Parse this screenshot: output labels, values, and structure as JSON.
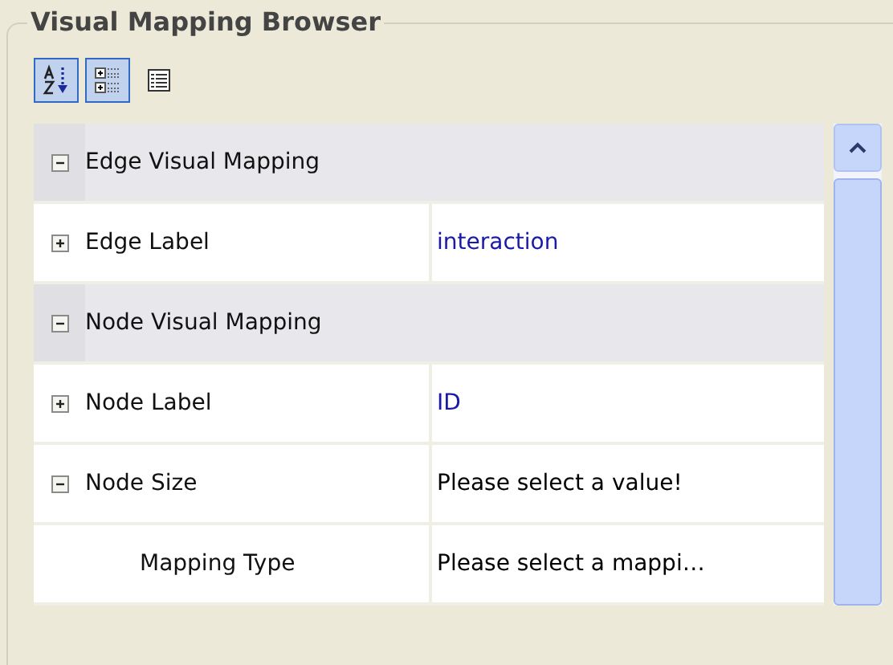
{
  "panel": {
    "title": "Visual Mapping Browser"
  },
  "toolbar": [
    {
      "kind": "sort",
      "selected": true
    },
    {
      "kind": "categories",
      "selected": true
    },
    {
      "kind": "list",
      "selected": false
    }
  ],
  "rows": [
    {
      "kind": "category",
      "label": "Edge Visual Mapping",
      "expanded": true,
      "children": [
        {
          "kind": "property",
          "label": "Edge Label",
          "value": "interaction",
          "color": "#1a1aa8",
          "expanded": false
        }
      ]
    },
    {
      "kind": "category",
      "label": "Node Visual Mapping",
      "expanded": true,
      "children": [
        {
          "kind": "property",
          "label": "Node Label",
          "value": "ID",
          "color": "#1a1aa8",
          "expanded": false
        },
        {
          "kind": "property",
          "label": "Node Size",
          "value": "Please select a value!",
          "color": "#000000",
          "expanded": true,
          "children": [
            {
              "kind": "property",
              "label": "Mapping Type",
              "value": "Please select a mappi…",
              "color": "#000000"
            }
          ]
        }
      ]
    }
  ]
}
